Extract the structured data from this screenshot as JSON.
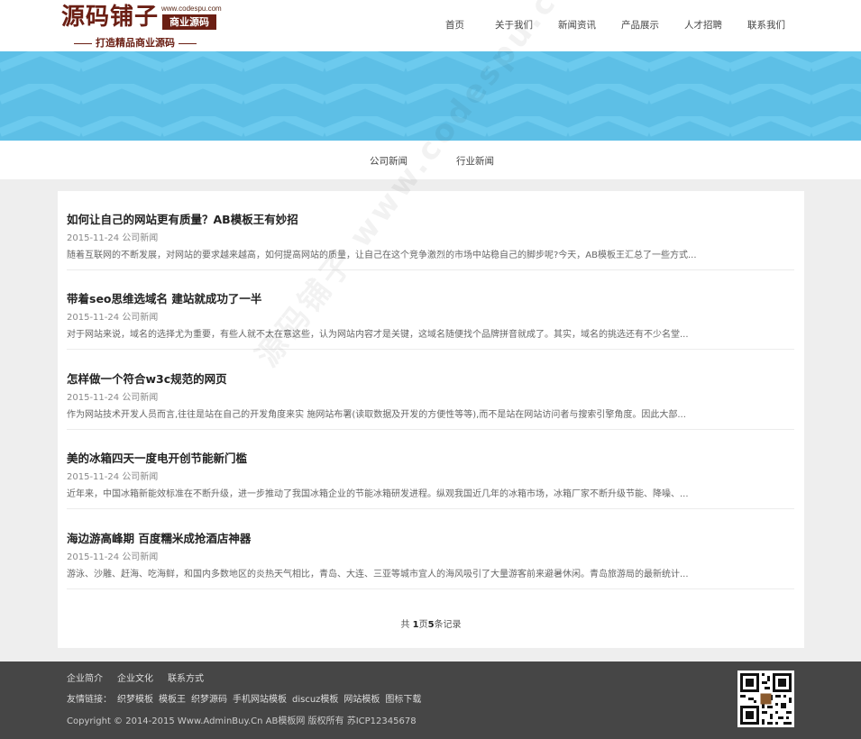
{
  "logo": {
    "main": "源码铺子",
    "url": "www.codespu.com",
    "badge": "商业源码",
    "slogan": "打造精品商业源码"
  },
  "nav": [
    "首页",
    "关于我们",
    "新闻资讯",
    "产品展示",
    "人才招聘",
    "联系我们"
  ],
  "subnav": [
    "公司新闻",
    "行业新闻"
  ],
  "articles": [
    {
      "title": "如何让自己的网站更有质量？AB模板王有妙招",
      "date": "2015-11-24",
      "category": "公司新闻",
      "summary": "随着互联网的不断发展，对网站的要求越来越高，如何提高网站的质量，让自己在这个竞争激烈的市场中站稳自己的脚步呢?今天，AB模板王汇总了一些方式..."
    },
    {
      "title": "带着seo思维选域名 建站就成功了一半",
      "date": "2015-11-24",
      "category": "公司新闻",
      "summary": "对于网站来说，域名的选择尤为重要，有些人就不太在意这些，认为网站内容才是关键，这域名随便找个品牌拼音就成了。其实，域名的挑选还有不少名堂..."
    },
    {
      "title": "怎样做一个符合w3c规范的网页",
      "date": "2015-11-24",
      "category": "公司新闻",
      "summary": "作为网站技术开发人员而言,往往是站在自己的开发角度来实 施网站布署(读取数据及开发的方便性等等),而不是站在网站访问者与搜索引擎角度。因此大部..."
    },
    {
      "title": "美的冰箱四天一度电开创节能新门槛",
      "date": "2015-11-24",
      "category": "公司新闻",
      "summary": "近年来，中国冰箱新能效标准在不断升级，进一步推动了我国冰箱企业的节能冰箱研发进程。纵观我国近几年的冰箱市场，冰箱厂家不断升级节能、降噪、..."
    },
    {
      "title": "海边游高峰期 百度糯米成抢酒店神器",
      "date": "2015-11-24",
      "category": "公司新闻",
      "summary": "游泳、沙雕、赶海、吃海鲜，和国内多数地区的炎热天气相比，青岛、大连、三亚等城市宜人的海风吸引了大量游客前来避暑休闲。青岛旅游局的最新统计..."
    }
  ],
  "pager": {
    "prefix": "共 ",
    "pages": "1",
    "mid": "页",
    "records": "5",
    "suffix": "条记录"
  },
  "watermark": "源码铺子 www.codespu.com",
  "footer": {
    "links": [
      "企业简介",
      "企业文化",
      "联系方式"
    ],
    "friend_label": "友情链接：",
    "friend_links": [
      "织梦模板",
      "模板王",
      "织梦源码",
      "手机网站模板",
      "discuz模板",
      "网站模板",
      "图标下载"
    ],
    "copyright": "Copyright © 2014-2015 Www.AdminBuy.Cn AB模板网 版权所有   苏ICP12345678"
  },
  "colors": {
    "banner": "#5dbfe6",
    "brand": "#6b1f14",
    "footer": "#464646"
  }
}
